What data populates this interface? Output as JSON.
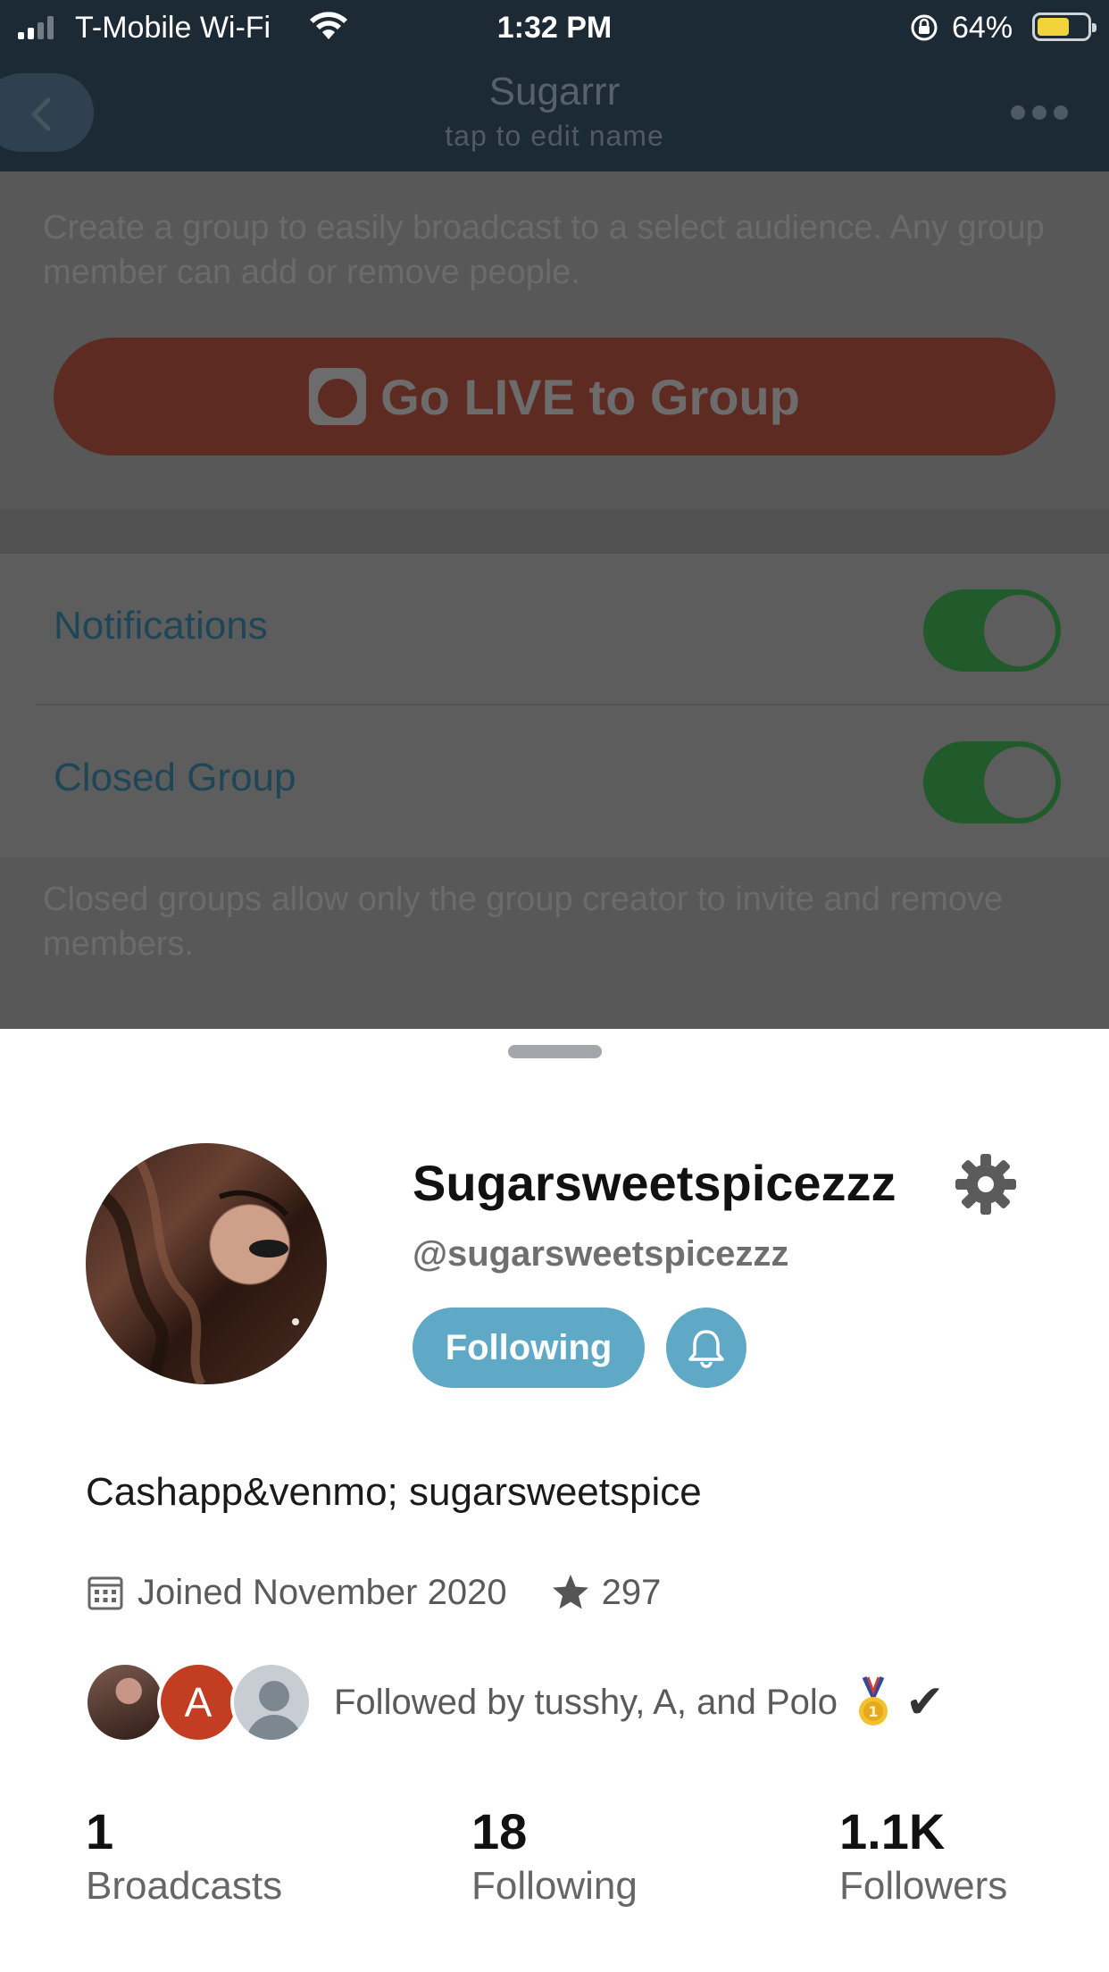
{
  "status_bar": {
    "carrier": "T-Mobile Wi-Fi",
    "time": "1:32 PM",
    "battery_percent": "64%",
    "battery_level": 0.64,
    "battery_color": "#f2d33b"
  },
  "nav": {
    "title": "Sugarrr",
    "subtitle": "tap to edit name",
    "back_icon": "chevron-left-icon",
    "more_icon": "more-horizontal-icon"
  },
  "group_settings": {
    "intro": "Create a group to easily broadcast to a select audience. Any group member can add or remove people.",
    "go_live_label": "Go LIVE to Group",
    "notifications_label": "Notifications",
    "notifications_on": true,
    "closed_group_label": "Closed Group",
    "closed_group_on": true,
    "closed_group_note": "Closed groups allow only the group creator to invite and remove members."
  },
  "profile": {
    "display_name": "Sugarsweetspicezzz",
    "handle": "@sugarsweetspicezzz",
    "following_button": "Following",
    "bio": "Cashapp&venmo; sugarsweetspice",
    "joined": "Joined November 2020",
    "stars": "297",
    "followed_by": "Followed by tusshy, A, and Polo",
    "follower_initial": "A",
    "accent_color": "#5fa8c6",
    "stats": [
      {
        "value": "1",
        "label": "Broadcasts"
      },
      {
        "value": "18",
        "label": "Following"
      },
      {
        "value": "1.1K",
        "label": "Followers"
      }
    ]
  }
}
